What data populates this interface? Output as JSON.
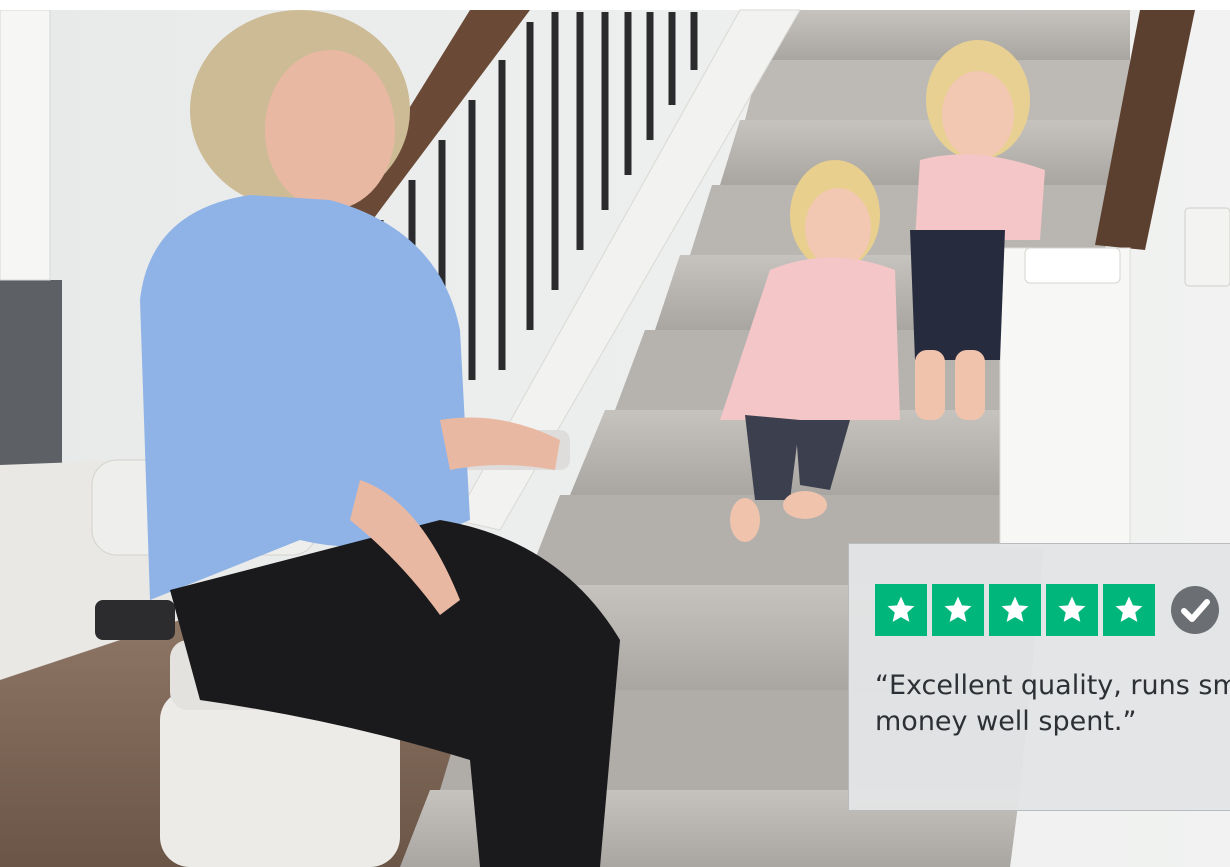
{
  "review": {
    "rating": 5,
    "max_rating": 5,
    "verified": true,
    "quote": "“Excellent quality, runs sm\nmoney well spent.”",
    "star_color": "#00b67a",
    "verified_color": "#6b6e72"
  },
  "colors": {
    "wall": "#eceeed",
    "carpet": "#b7b4b0",
    "handrail": "#6a4a37",
    "sweater": "#8fb3e6",
    "dress": "#f4c6c7"
  }
}
